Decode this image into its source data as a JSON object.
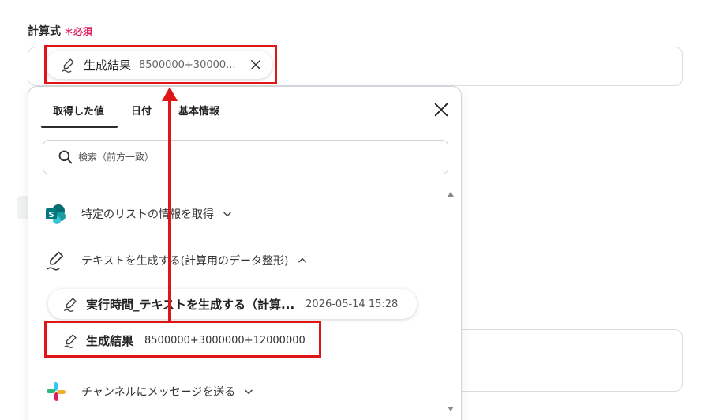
{
  "field": {
    "label": "計算式",
    "required_mark": "＊",
    "required_text": "必須"
  },
  "selected_chip": {
    "title": "生成結果",
    "value": "8500000+30000..."
  },
  "dropdown": {
    "tabs": [
      {
        "label": "取得した値",
        "active": true
      },
      {
        "label": "日付",
        "active": false
      },
      {
        "label": "基本情報",
        "active": false
      }
    ],
    "search_placeholder": "検索（前方一致）",
    "groups": [
      {
        "label": "特定のリストの情報を取得",
        "icon": "sharepoint-icon",
        "expanded": false
      },
      {
        "label": "テキストを生成する(計算用のデータ整形)",
        "icon": "pen-icon",
        "expanded": true
      },
      {
        "label": "チャンネルにメッセージを送る",
        "icon": "slack-icon",
        "expanded": false
      }
    ],
    "items": [
      {
        "title": "実行時間_テキストを生成する（計算...",
        "value": "2026-05-14 15:28"
      },
      {
        "title": "生成結果",
        "value": "8500000+3000000+12000000"
      }
    ]
  },
  "colors": {
    "annotation_red": "#e01515",
    "required_pink": "#e0245e",
    "border_gray": "#d9dde3"
  }
}
